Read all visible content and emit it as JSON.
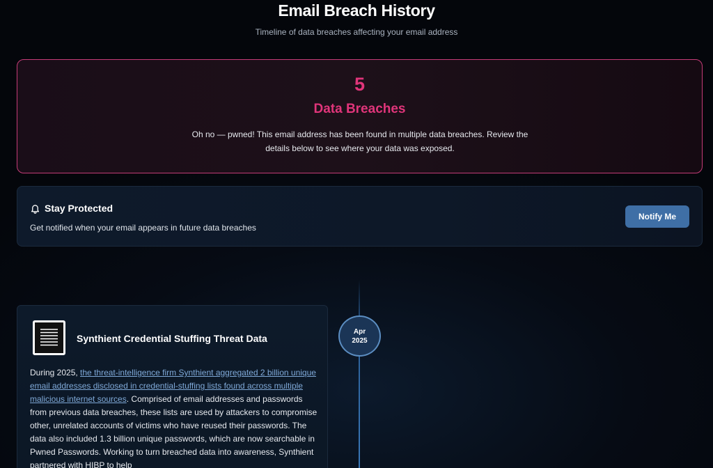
{
  "header": {
    "title": "Email Breach History",
    "subtitle": "Timeline of data breaches affecting your email address"
  },
  "alert": {
    "count": "5",
    "label": "Data Breaches",
    "message": "Oh no — pwned! This email address has been found in multiple data breaches. Review the details below to see where your data was exposed.",
    "accent_color": "#e0357a"
  },
  "protect": {
    "icon": "bell-icon",
    "title": "Stay Protected",
    "text": "Get notified when your email appears in future data breaches",
    "button_label": "Notify Me"
  },
  "timeline": {
    "entries": [
      {
        "month": "Apr",
        "year": "2025",
        "title": "Synthient Credential Stuffing Threat Data",
        "logo_icon": "document-icon",
        "desc_prefix": "During 2025, ",
        "desc_link": "the threat-intelligence firm Synthient aggregated 2 billion unique email addresses disclosed in credential-stuffing lists found across multiple malicious internet sources",
        "desc_suffix": ". Comprised of email addresses and passwords from previous data breaches, these lists are used by attackers to compromise other, unrelated accounts of victims who have reused their passwords. The data also included 1.3 billion unique passwords, which are now searchable in Pwned Passwords. Working to turn breached data into awareness, Synthient partnered with HIBP to help"
      }
    ]
  }
}
